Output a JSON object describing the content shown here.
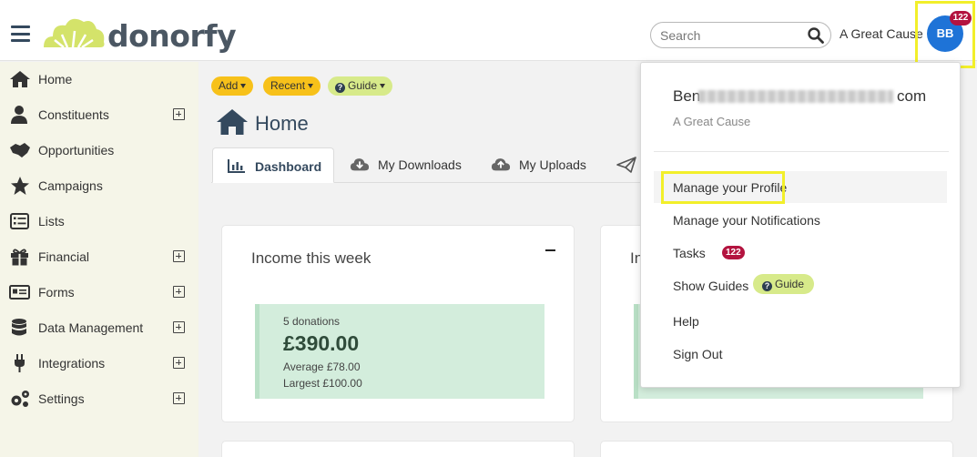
{
  "header": {
    "brand": "donorfy",
    "search_placeholder": "Search",
    "org_name": "A Great Cause",
    "avatar_initials": "BB",
    "notification_count": "122"
  },
  "sidebar": {
    "items": [
      {
        "label": "Home",
        "icon": "home-icon",
        "expandable": false
      },
      {
        "label": "Constituents",
        "icon": "person-icon",
        "expandable": true
      },
      {
        "label": "Opportunities",
        "icon": "handshake-icon",
        "expandable": false
      },
      {
        "label": "Campaigns",
        "icon": "star-icon",
        "expandable": false
      },
      {
        "label": "Lists",
        "icon": "list-icon",
        "expandable": false
      },
      {
        "label": "Financial",
        "icon": "gift-icon",
        "expandable": true
      },
      {
        "label": "Forms",
        "icon": "form-icon",
        "expandable": true
      },
      {
        "label": "Data Management",
        "icon": "database-icon",
        "expandable": true
      },
      {
        "label": "Integrations",
        "icon": "plug-icon",
        "expandable": true
      },
      {
        "label": "Settings",
        "icon": "gears-icon",
        "expandable": true
      }
    ]
  },
  "toolbar": {
    "add_label": "Add",
    "recent_label": "Recent",
    "guide_label": "Guide"
  },
  "page": {
    "title": "Home"
  },
  "tabs": [
    {
      "label": "Dashboard",
      "active": true
    },
    {
      "label": "My Downloads",
      "active": false
    },
    {
      "label": "My Uploads",
      "active": false
    }
  ],
  "cards": {
    "income_week": {
      "title": "Income this week",
      "donations": "5 donations",
      "amount": "£390.00",
      "average": "Average £78.00",
      "largest": "Largest £100.00"
    },
    "second_card_title_fragment": "In"
  },
  "dropdown": {
    "user_name_start": "Ben",
    "user_name_end": "com",
    "org": "A Great Cause",
    "items": [
      {
        "label": "Manage your Profile"
      },
      {
        "label": "Manage your Notifications"
      },
      {
        "label": "Tasks",
        "badge": "122"
      },
      {
        "label": "Show Guides",
        "pill": "Guide"
      },
      {
        "label": "Help"
      },
      {
        "label": "Sign Out"
      }
    ]
  },
  "colors": {
    "accent_yellow": "#f7c11a",
    "guide_green": "#d7ea8a",
    "avatar_blue": "#1e73d7",
    "badge_red": "#b3133f",
    "highlight": "#f2ef2a",
    "sidebar_bg": "#f5f5e8",
    "stat_green": "#d3eddc"
  }
}
